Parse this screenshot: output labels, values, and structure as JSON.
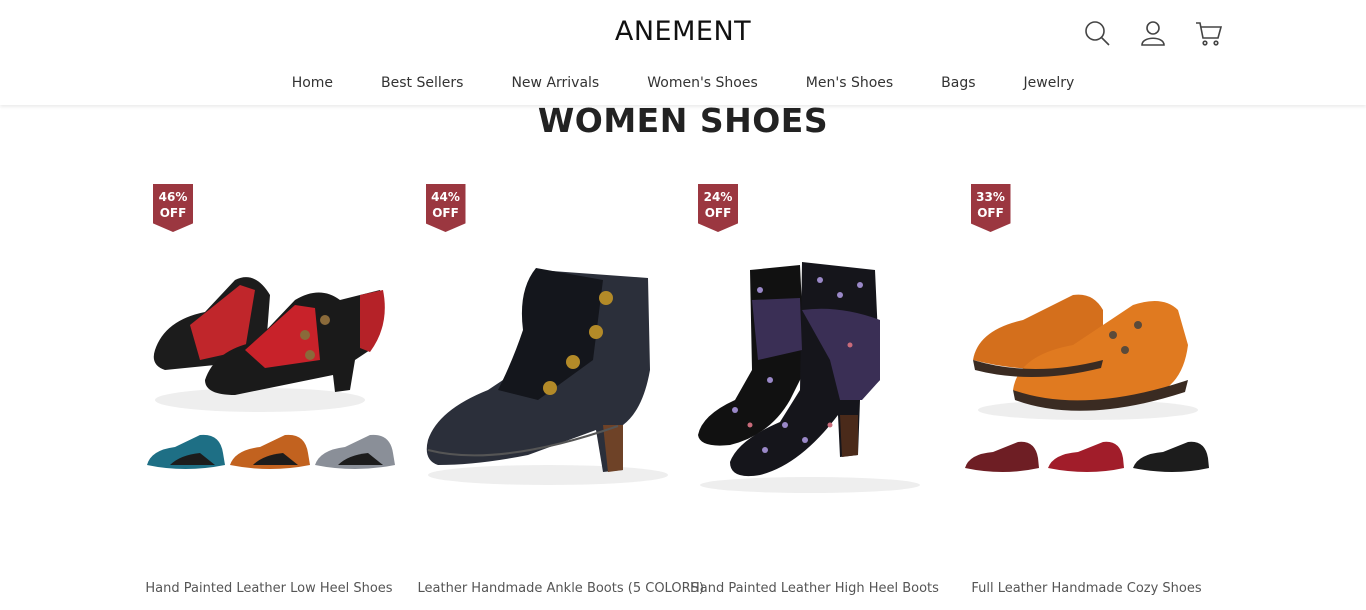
{
  "brand": "ANEMENT",
  "header_icons": [
    "search-icon",
    "user-icon",
    "cart-icon"
  ],
  "nav": [
    "Home",
    "Best Sellers",
    "New Arrivals",
    "Women's Shoes",
    "Men's Shoes",
    "Bags",
    "Jewelry"
  ],
  "section_title": "WOMEN SHOES",
  "colors": {
    "badge": "#9b3740"
  },
  "products": [
    {
      "name": "Hand Painted Leather Low Heel Shoes",
      "discount": "46%",
      "off": "OFF"
    },
    {
      "name": "Leather Handmade Ankle Boots (5 COLORS)",
      "discount": "44%",
      "off": "OFF"
    },
    {
      "name": "Hand Painted Leather High Heel Boots",
      "discount": "24%",
      "off": "OFF"
    },
    {
      "name": "Full Leather Handmade Cozy Shoes",
      "discount": "33%",
      "off": "OFF"
    }
  ]
}
